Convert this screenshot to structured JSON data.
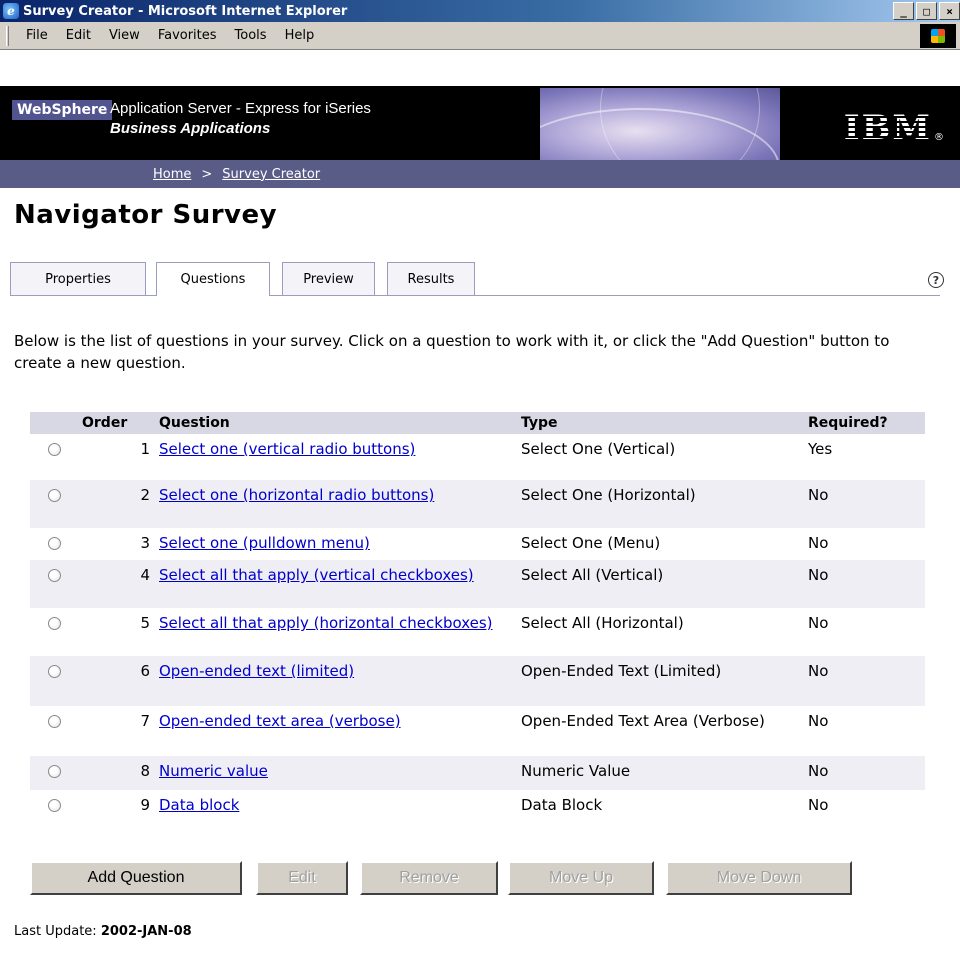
{
  "window": {
    "title": "Survey Creator - Microsoft Internet Explorer",
    "minimize": "_",
    "maximize": "□",
    "close": "×"
  },
  "menu": [
    "File",
    "Edit",
    "View",
    "Favorites",
    "Tools",
    "Help"
  ],
  "banner": {
    "brand": "WebSphere",
    "title": "Application Server - Express for iSeries",
    "subtitle": "Business Applications",
    "logo": "IBM",
    "logo_mark": "®"
  },
  "breadcrumb": {
    "home": "Home",
    "separator": ">",
    "current": "Survey Creator"
  },
  "page": {
    "title": "Navigator Survey",
    "intro": "Below is the list of questions in your survey. Click on a question to work with it, or click the \"Add Question\" button to create a new question."
  },
  "tabs": [
    "Properties",
    "Questions",
    "Preview",
    "Results"
  ],
  "active_tab": "Questions",
  "help_icon": "?",
  "table": {
    "headers": {
      "order": "Order",
      "question": "Question",
      "type": "Type",
      "required": "Required?"
    },
    "rows": [
      {
        "order": "1",
        "question": "Select one (vertical radio buttons)",
        "type": "Select One (Vertical)",
        "required": "Yes"
      },
      {
        "order": "2",
        "question": "Select one (horizontal radio buttons)",
        "type": "Select One (Horizontal)",
        "required": "No"
      },
      {
        "order": "3",
        "question": "Select one (pulldown menu)",
        "type": "Select One (Menu)",
        "required": "No"
      },
      {
        "order": "4",
        "question": "Select all that apply (vertical checkboxes)",
        "type": "Select All (Vertical)",
        "required": "No"
      },
      {
        "order": "5",
        "question": "Select all that apply (horizontal checkboxes)",
        "type": "Select All (Horizontal)",
        "required": "No"
      },
      {
        "order": "6",
        "question": "Open-ended text (limited)",
        "type": "Open-Ended Text (Limited)",
        "required": "No"
      },
      {
        "order": "7",
        "question": "Open-ended text area (verbose)",
        "type": "Open-Ended Text Area (Verbose)",
        "required": "No"
      },
      {
        "order": "8",
        "question": "Numeric value",
        "type": "Numeric Value",
        "required": "No"
      },
      {
        "order": "9",
        "question": "Data block",
        "type": "Data Block",
        "required": "No"
      }
    ]
  },
  "buttons": {
    "add": "Add Question",
    "edit": "Edit",
    "remove": "Remove",
    "move_up": "Move Up",
    "move_down": "Move Down"
  },
  "footer": {
    "label": "Last Update:",
    "date": "2002-JAN-08"
  }
}
